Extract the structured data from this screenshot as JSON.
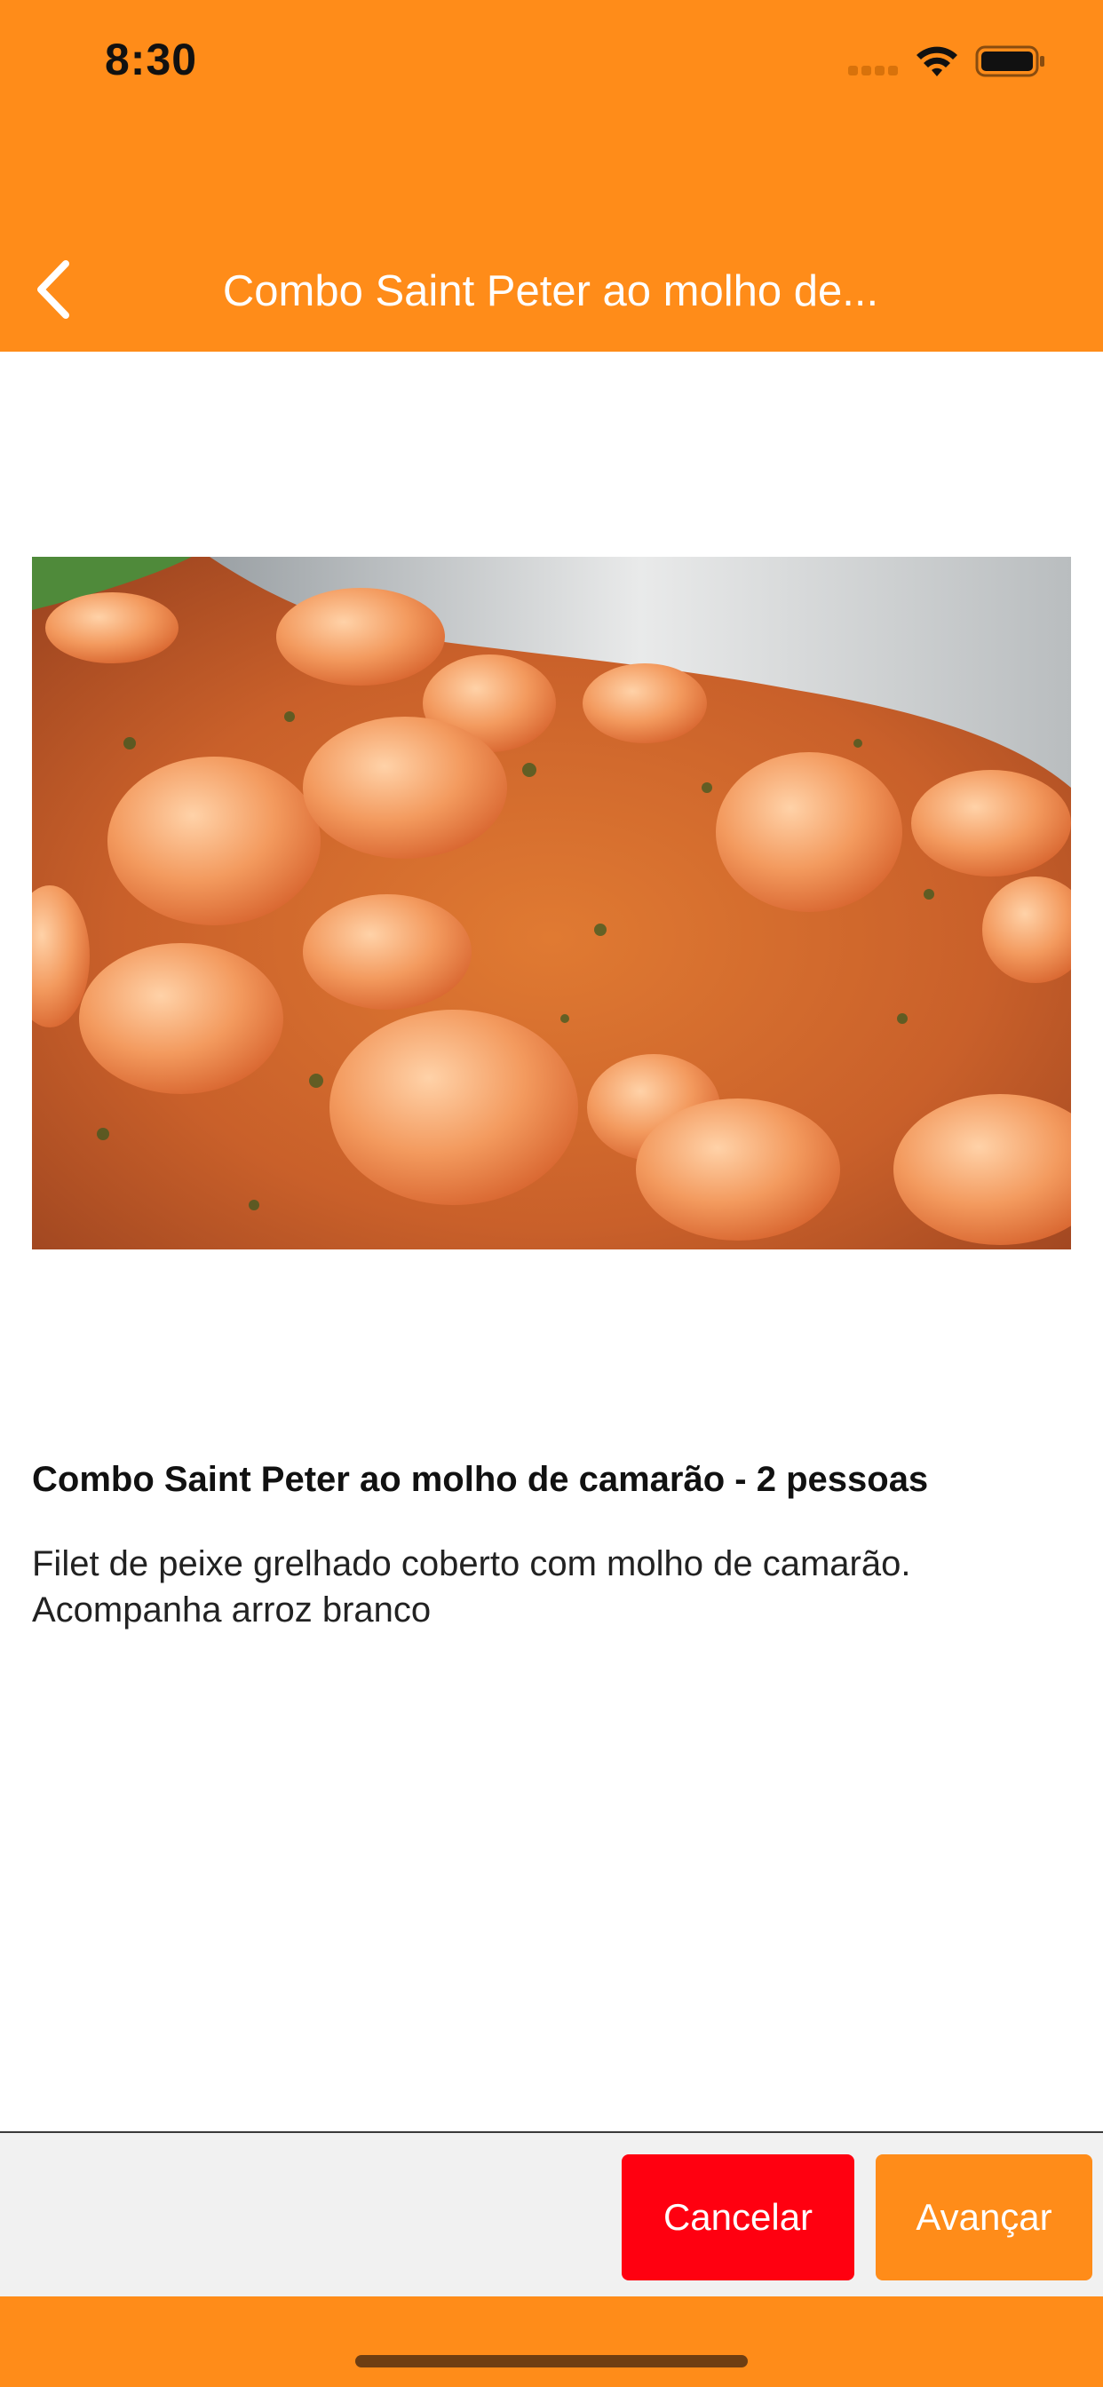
{
  "status_bar": {
    "time": "8:30",
    "icons": [
      "signal-icon",
      "wifi-icon",
      "battery-icon"
    ]
  },
  "nav": {
    "back_icon": "chevron-left-icon",
    "title": "Combo Saint Peter ao molho de..."
  },
  "product": {
    "image_subject": "shrimp-sauce-dish",
    "name": "Combo Saint Peter ao molho de camarão - 2 pessoas",
    "description_line1": "Filet de peixe grelhado coberto com molho de camarão.",
    "description_line2": "Acompanha arroz branco"
  },
  "actions": {
    "cancel_label": "Cancelar",
    "next_label": "Avançar"
  },
  "colors": {
    "brand_orange": "#FF8C19",
    "cancel_red": "#FF0010",
    "footer_bg": "#F1F1F1"
  }
}
